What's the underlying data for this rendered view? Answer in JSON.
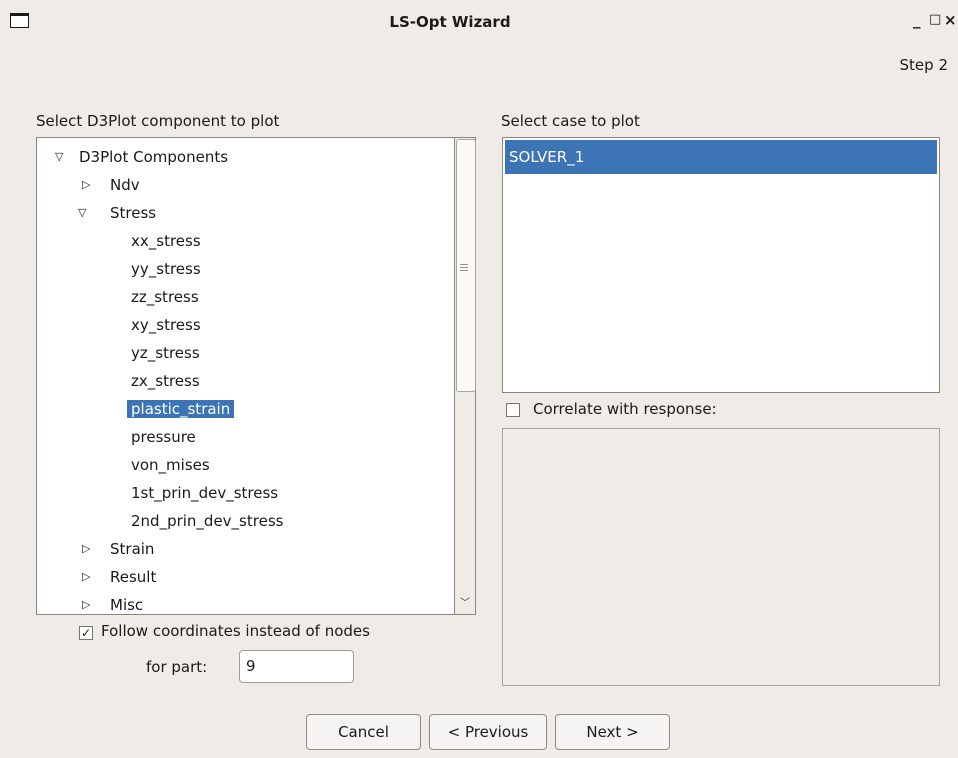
{
  "window": {
    "title": "LS-Opt Wizard",
    "controls": [
      "_",
      "□",
      "×"
    ]
  },
  "step_label": "Step 2",
  "left_panel": {
    "label": "Select D3Plot component to plot",
    "tree": {
      "root": "D3Plot Components",
      "ndv": "Ndv",
      "stress": "Stress",
      "stress_children": [
        "xx_stress",
        "yy_stress",
        "zz_stress",
        "xy_stress",
        "yz_stress",
        "zx_stress",
        "plastic_strain",
        "pressure",
        "von_mises",
        "1st_prin_dev_stress",
        "2nd_prin_dev_stress"
      ],
      "strain": "Strain",
      "result": "Result",
      "misc": "Misc",
      "selected": "plastic_strain"
    },
    "follow_checkbox": {
      "label": "Follow coordinates instead of nodes",
      "checked": true
    },
    "part_label": "for part:",
    "part_value": "9"
  },
  "right_panel": {
    "label": "Select case to plot",
    "cases": [
      "SOLVER_1"
    ],
    "correlate_checkbox": {
      "label": "Correlate with response:",
      "checked": false
    }
  },
  "buttons": {
    "cancel": "Cancel",
    "previous": "< Previous",
    "next": "Next >"
  },
  "colors": {
    "selection": "#3d74b5",
    "window_bg": "#efebe7"
  }
}
